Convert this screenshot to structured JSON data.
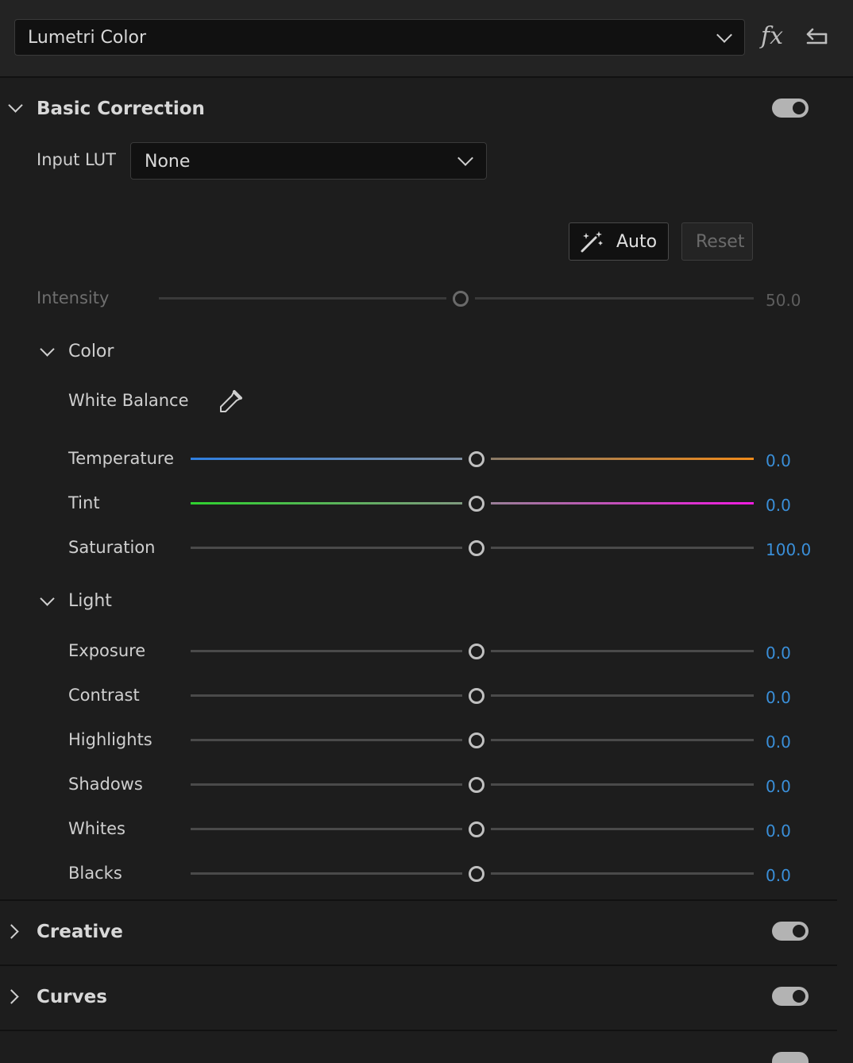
{
  "header": {
    "effect": "Lumetri Color",
    "fx_label": "fx"
  },
  "basic_correction": {
    "title": "Basic Correction",
    "enabled": true,
    "input_lut_label": "Input LUT",
    "input_lut_value": "None",
    "auto_label": "Auto",
    "reset_label": "Reset",
    "intensity_label": "Intensity",
    "intensity_value": "50.0"
  },
  "color": {
    "title": "Color",
    "white_balance_label": "White Balance",
    "sliders": [
      {
        "label": "Temperature",
        "value": "0.0"
      },
      {
        "label": "Tint",
        "value": "0.0"
      },
      {
        "label": "Saturation",
        "value": "100.0"
      }
    ]
  },
  "light": {
    "title": "Light",
    "sliders": [
      {
        "label": "Exposure",
        "value": "0.0"
      },
      {
        "label": "Contrast",
        "value": "0.0"
      },
      {
        "label": "Highlights",
        "value": "0.0"
      },
      {
        "label": "Shadows",
        "value": "0.0"
      },
      {
        "label": "Whites",
        "value": "0.0"
      },
      {
        "label": "Blacks",
        "value": "0.0"
      }
    ]
  },
  "sections": [
    {
      "title": "Creative",
      "enabled": true
    },
    {
      "title": "Curves",
      "enabled": true
    }
  ],
  "colors": {
    "value_blue": "#3a8fd9",
    "temperature_cool": "#2f7fe0",
    "temperature_warm": "#f08a1a",
    "tint_green": "#2fd12f",
    "tint_magenta": "#f01ce0"
  }
}
